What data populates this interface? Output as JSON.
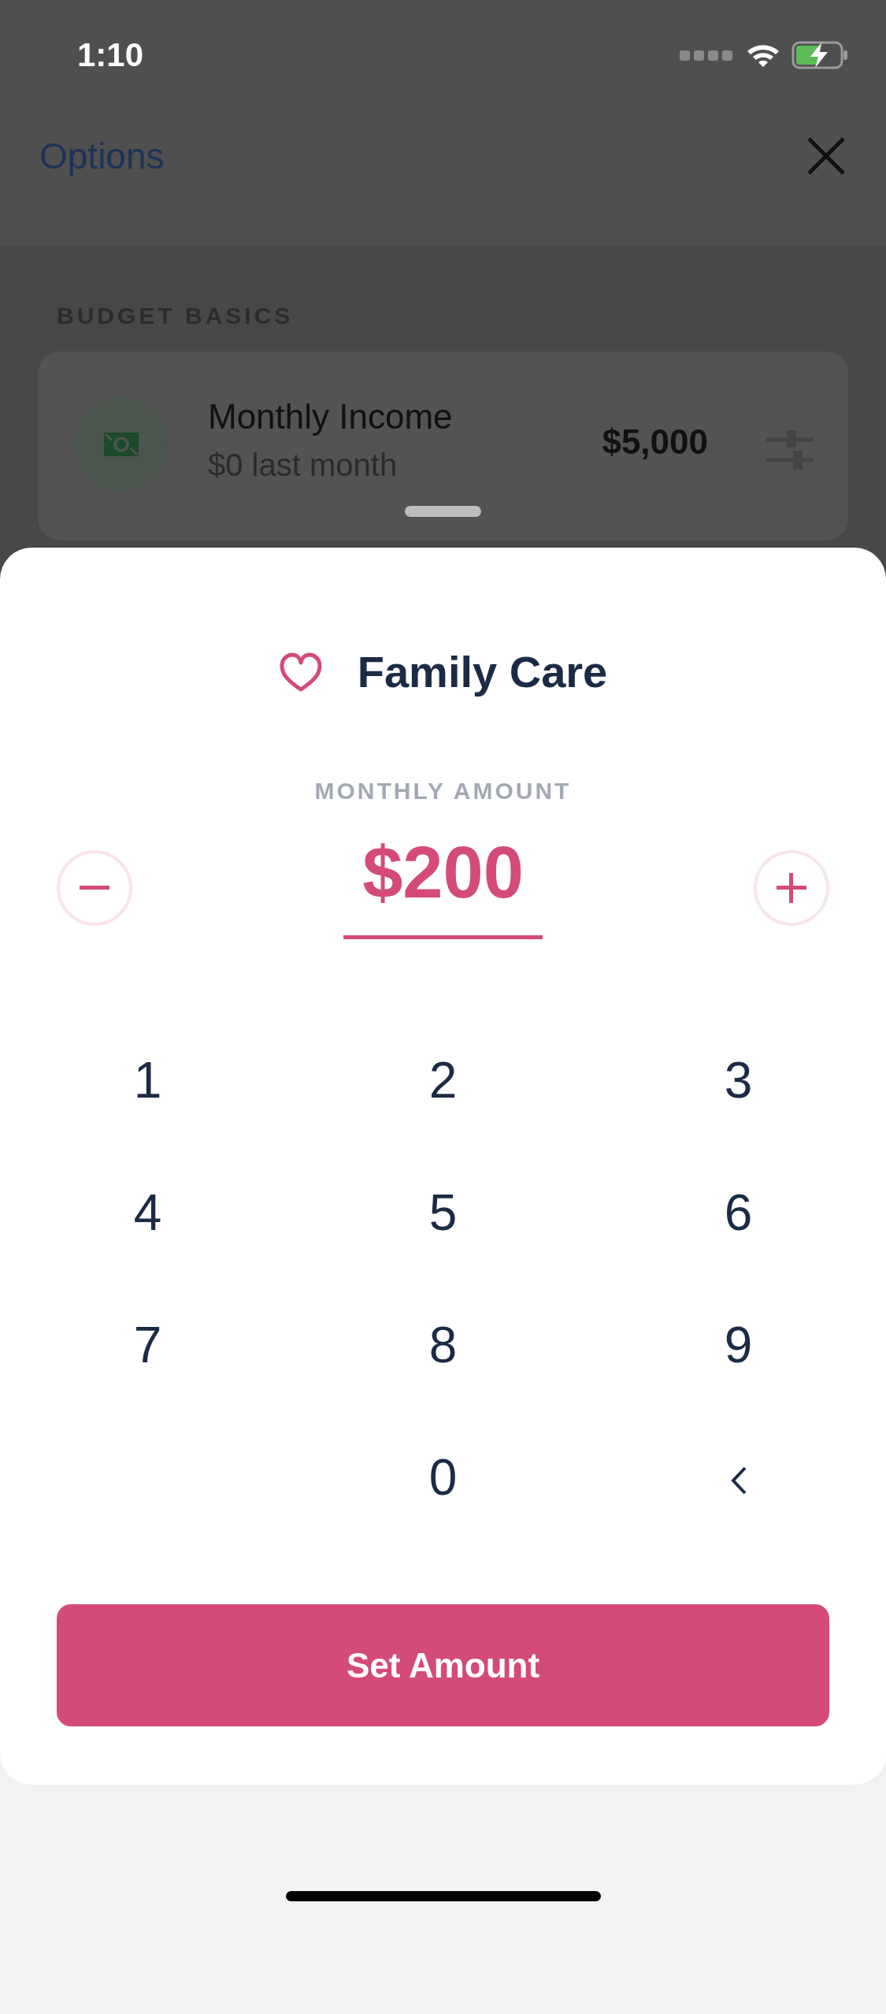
{
  "status_bar": {
    "time": "1:10"
  },
  "header": {
    "back_label": "Options"
  },
  "section": {
    "title": "BUDGET BASICS"
  },
  "income_card": {
    "title": "Monthly Income",
    "subtitle": "$0 last month",
    "amount": "$5,000"
  },
  "sheet": {
    "category": "Family Care",
    "amount_label": "MONTHLY AMOUNT",
    "amount": "$200",
    "keys": [
      {
        "kind": "digit",
        "label": "1"
      },
      {
        "kind": "digit",
        "label": "2"
      },
      {
        "kind": "digit",
        "label": "3"
      },
      {
        "kind": "digit",
        "label": "4"
      },
      {
        "kind": "digit",
        "label": "5"
      },
      {
        "kind": "digit",
        "label": "6"
      },
      {
        "kind": "digit",
        "label": "7"
      },
      {
        "kind": "digit",
        "label": "8"
      },
      {
        "kind": "digit",
        "label": "9"
      },
      {
        "kind": "blank"
      },
      {
        "kind": "digit",
        "label": "0"
      },
      {
        "kind": "backspace"
      }
    ],
    "button": "Set Amount"
  }
}
